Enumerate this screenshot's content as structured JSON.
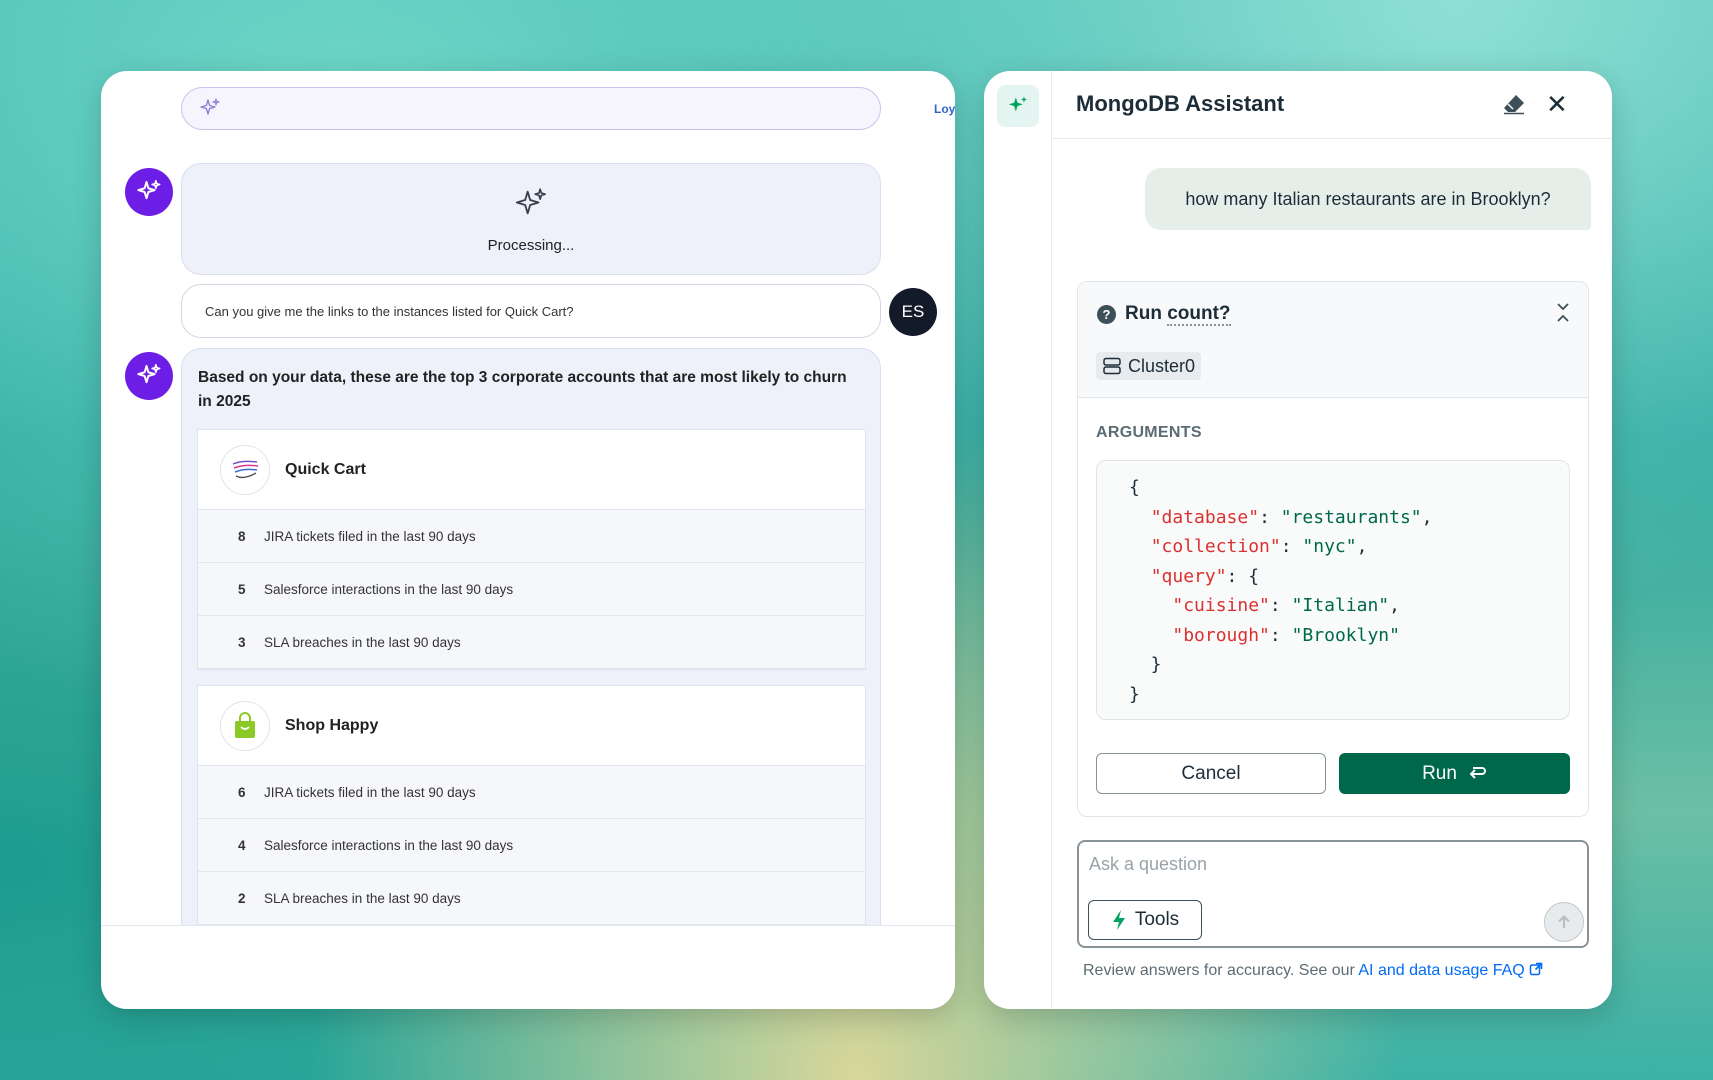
{
  "left": {
    "search": {
      "value": "",
      "placeholder": ""
    },
    "cut_text": "Loy",
    "processing": {
      "label": "Processing..."
    },
    "user_message": {
      "text": "Can you give me the links to the instances listed for Quick Cart?",
      "avatar_initials": "ES"
    },
    "answer": {
      "text": "Based on your data, these are the top 3 corporate accounts that are most likely to churn in 2025",
      "accounts": [
        {
          "name": "Quick Cart",
          "metrics": [
            {
              "value": "8",
              "label": "JIRA tickets filed in the last 90 days"
            },
            {
              "value": "5",
              "label": "Salesforce interactions in the last 90 days"
            },
            {
              "value": "3",
              "label": "SLA breaches in the last 90 days"
            }
          ]
        },
        {
          "name": "Shop Happy",
          "metrics": [
            {
              "value": "6",
              "label": "JIRA tickets filed in the last 90 days"
            },
            {
              "value": "4",
              "label": "Salesforce interactions in the last 90 days"
            },
            {
              "value": "2",
              "label": "SLA breaches in the last 90 days"
            }
          ]
        }
      ]
    }
  },
  "right": {
    "title": "MongoDB Assistant",
    "user_message": "how many Italian restaurants are in Brooklyn?",
    "tool": {
      "prefix": "Run ",
      "name": "count?",
      "cluster": "Cluster0",
      "arguments_label": "ARGUMENTS",
      "cancel_label": "Cancel",
      "run_label": "Run"
    },
    "ask": {
      "placeholder": "Ask a question",
      "tools_label": "Tools"
    },
    "disclaimer": {
      "text": "Review answers for accuracy. See our ",
      "link": "AI and data usage FAQ"
    }
  },
  "colors": {
    "bot_avatar": "#6d1ee6",
    "run_button": "#00684a",
    "code_key": "#db3030",
    "code_string": "#00684a",
    "link": "#016bf8"
  }
}
